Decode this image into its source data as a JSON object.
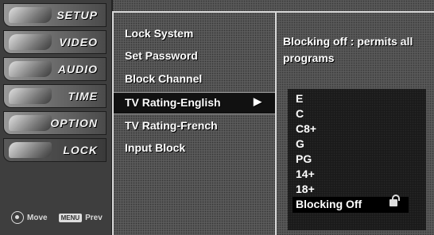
{
  "sidebar": {
    "items": [
      {
        "label": "SETUP"
      },
      {
        "label": "VIDEO"
      },
      {
        "label": "AUDIO"
      },
      {
        "label": "TIME"
      },
      {
        "label": "OPTION"
      },
      {
        "label": "LOCK"
      }
    ],
    "active": "LOCK",
    "footer": {
      "move_label": "Move",
      "prev_key": "MENU",
      "prev_label": "Prev"
    }
  },
  "menu": {
    "items": [
      {
        "label": "Lock System"
      },
      {
        "label": "Set Password"
      },
      {
        "label": "Block Channel"
      },
      {
        "label": "TV Rating-English",
        "arrow": "▶"
      },
      {
        "label": "TV Rating-French"
      },
      {
        "label": "Input Block"
      }
    ],
    "selected": "TV Rating-English"
  },
  "panel": {
    "info_text": "Blocking off : permits all programs",
    "ratings": [
      "E",
      "C",
      "C8+",
      "G",
      "PG",
      "14+",
      "18+",
      "Blocking Off"
    ],
    "current_rating": "Blocking Off",
    "current_icon": "lock-icon"
  }
}
